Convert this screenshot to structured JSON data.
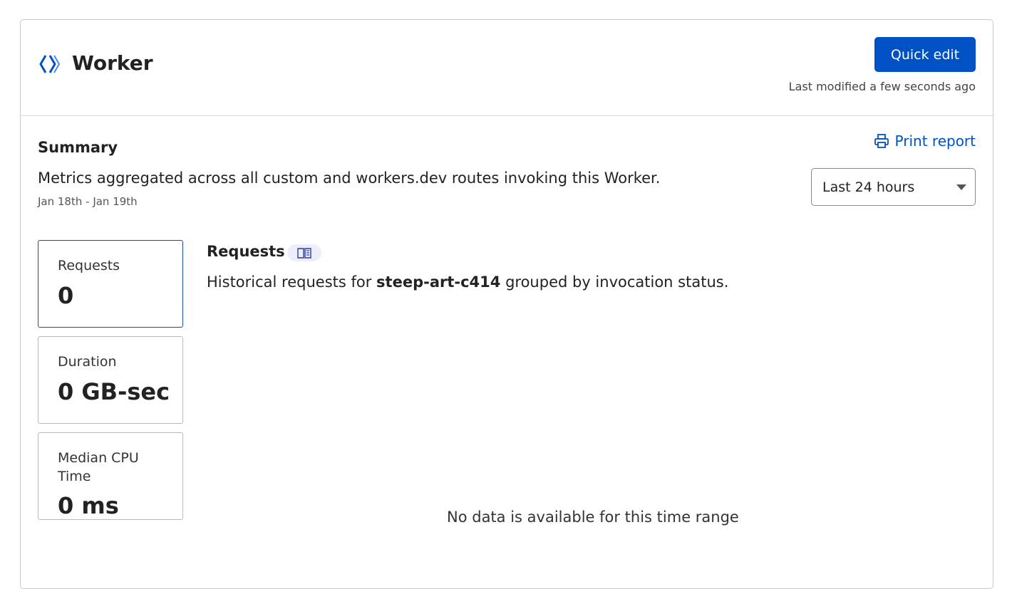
{
  "header": {
    "title": "Worker",
    "icon": "workers-chevrons-icon",
    "quick_edit_label": "Quick edit",
    "last_modified_label": "Last modified",
    "last_modified_value": "a few seconds ago"
  },
  "summary": {
    "title": "Summary",
    "description": "Metrics aggregated across all custom and workers.dev routes invoking this Worker.",
    "date_range": "Jan 18th - Jan 19th",
    "print_report_label": "Print report",
    "time_range_selected": "Last 24 hours"
  },
  "metrics": [
    {
      "label": "Requests",
      "value": "0",
      "active": true
    },
    {
      "label": "Duration",
      "value": "0 GB-sec",
      "active": false
    },
    {
      "label": "Median CPU Time",
      "value": "0 ms",
      "active": false
    }
  ],
  "requests_panel": {
    "title": "Requests",
    "desc_prefix": "Historical requests for",
    "worker_name": "steep-art-c414",
    "desc_suffix": "grouped by invocation status.",
    "empty_message": "No data is available for this time range"
  },
  "colors": {
    "accent": "#0051c3",
    "active_border": "#1c4f94",
    "badge_bg": "#eceefb"
  }
}
